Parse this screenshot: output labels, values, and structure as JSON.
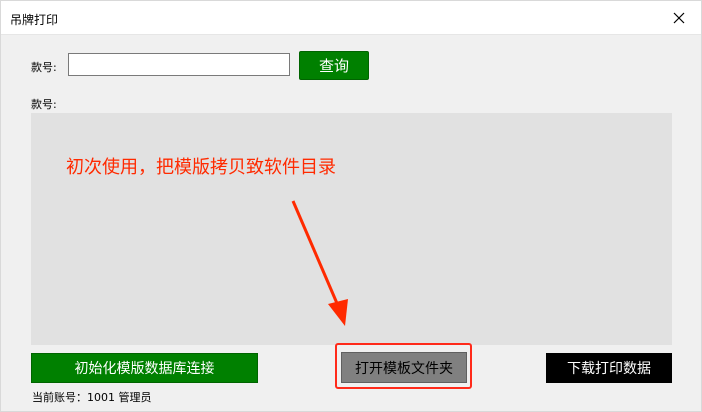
{
  "window": {
    "title": "吊牌打印"
  },
  "search": {
    "label": "款号:",
    "value": "",
    "placeholder": "",
    "button_label": "查询"
  },
  "panel": {
    "label": "款号:"
  },
  "annotation": {
    "text": "初次使用，把模版拷贝致软件目录",
    "color": "#ff2a00"
  },
  "buttons": {
    "init_label": "初始化模版数据库连接",
    "open_folder_label": "打开模板文件夹",
    "download_label": "下载打印数据"
  },
  "status": {
    "text": "当前账号：1001 管理员"
  },
  "icons": {
    "close": "close-icon"
  },
  "colors": {
    "green": "#008000",
    "annotation_red": "#ff2a00",
    "panel_bg": "#e1e1e1"
  }
}
